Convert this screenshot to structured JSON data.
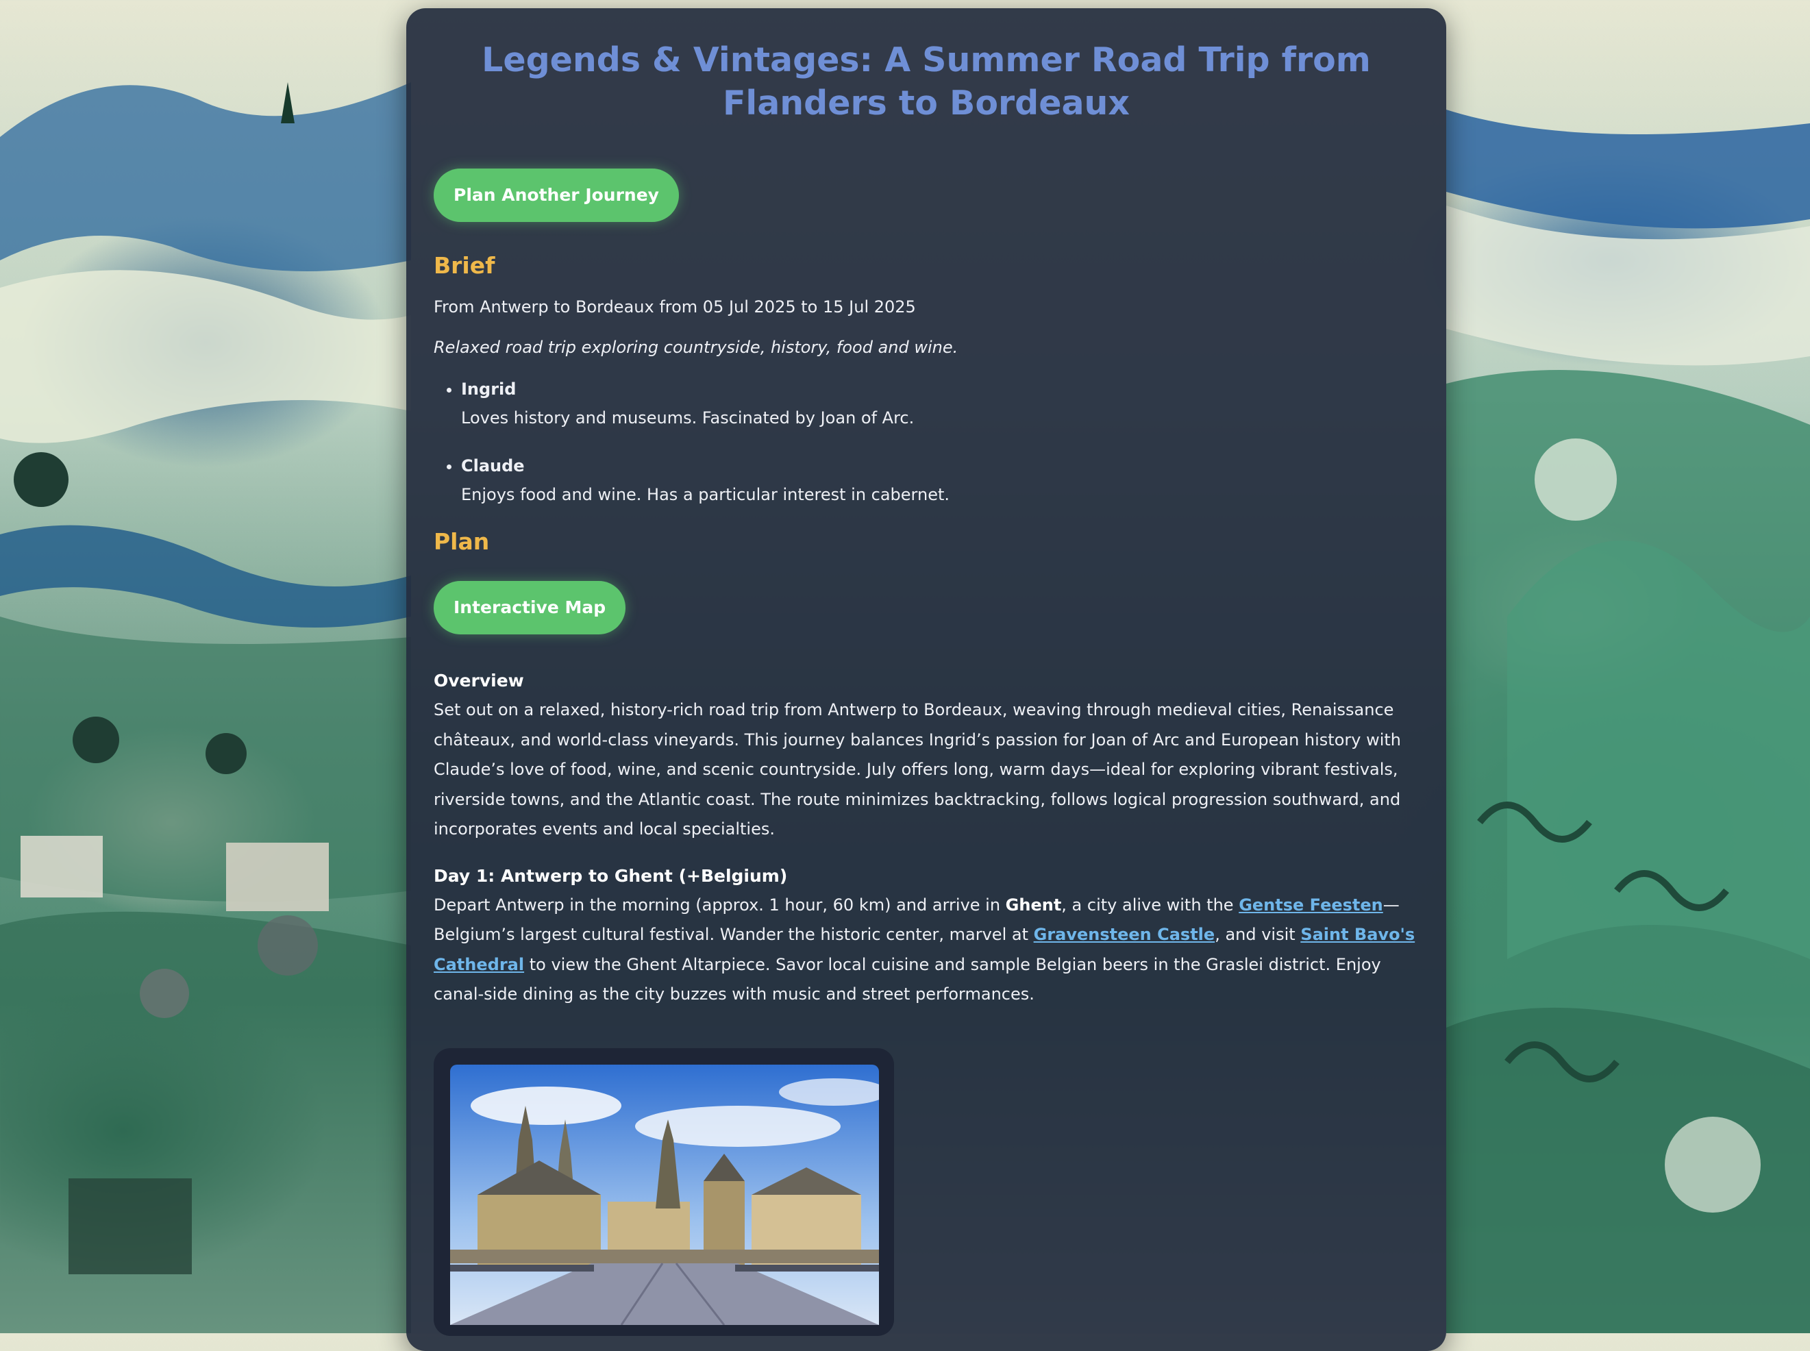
{
  "title": "Legends & Vintages: A Summer Road Trip from Flanders to Bordeaux",
  "buttons": {
    "plan_another": "Plan Another Journey",
    "interactive_map": "Interactive Map"
  },
  "brief": {
    "heading": "Brief",
    "route_line": "From Antwerp to Bordeaux from 05 Jul 2025 to 15 Jul 2025",
    "description": "Relaxed road trip exploring countryside, history, food and wine.",
    "travellers": [
      {
        "name": "Ingrid",
        "info": "Loves history and museums. Fascinated by Joan of Arc."
      },
      {
        "name": "Claude",
        "info": "Enjoys food and wine. Has a particular interest in cabernet."
      }
    ]
  },
  "plan": {
    "heading": "Plan",
    "overview": {
      "title": "Overview",
      "text": "Set out on a relaxed, history-rich road trip from Antwerp to Bordeaux, weaving through medieval cities, Renaissance châteaux, and world-class vineyards. This journey balances Ingrid’s passion for Joan of Arc and European history with Claude’s love of food, wine, and scenic countryside. July offers long, warm days—ideal for exploring vibrant festivals, riverside towns, and the Atlantic coast. The route minimizes backtracking, follows logical progression southward, and incorporates events and local specialties."
    },
    "day1": {
      "title": "Day 1: Antwerp to Ghent (+Belgium)",
      "t1": "Depart Antwerp in the morning (approx. 1 hour, 60 km) and arrive in ",
      "ghent": "Ghent",
      "t2": ", a city alive with the ",
      "link_feesten": "Gentse Feesten",
      "t3": "—Belgium’s largest cultural festival. Wander the historic center, marvel at ",
      "link_castle": "Gravensteen Castle",
      "t4": ", and visit ",
      "link_cathedral": "Saint Bavo's Cathedral",
      "t5": " to view the Ghent Altarpiece. Savor local cuisine and sample Belgian beers in the Graslei district. Enjoy canal-side dining as the city buzzes with music and street performances."
    }
  },
  "icons": {
    "background": "painted-landscape-background",
    "photo": "ghent-skyline-photo"
  },
  "colors": {
    "title": "#6f8fd6",
    "section_heading": "#efb84a",
    "button": "#5cc46d",
    "link": "#6fb6ea",
    "card": "#252d3e"
  }
}
